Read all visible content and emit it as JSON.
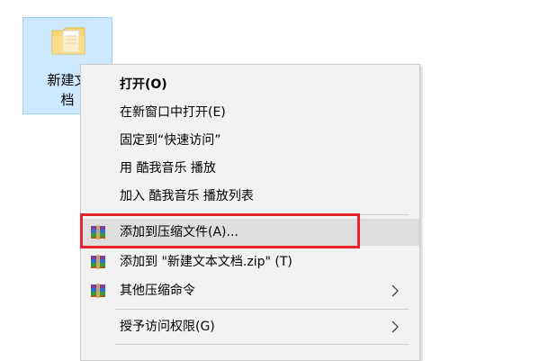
{
  "desktop": {
    "selected_item": {
      "name_line1": "新建文",
      "name_line2": "档",
      "icon": "text-document-icon"
    }
  },
  "context_menu": {
    "items": [
      {
        "label": "打开(O)",
        "bold": true
      },
      {
        "label": "在新窗口中打开(E)"
      },
      {
        "label": "固定到“快速访问”"
      },
      {
        "label": "用 酷我音乐 播放"
      },
      {
        "label": "加入 酷我音乐 播放列表"
      },
      {
        "label": "添加到压缩文件(A)...",
        "icon": "winrar-archive-icon",
        "highlighted": true
      },
      {
        "label": "添加到 \"新建文本文档.zip\" (T)",
        "icon": "winrar-archive-icon"
      },
      {
        "label": "其他压缩命令",
        "icon": "winrar-archive-icon",
        "submenu": true
      },
      {
        "label": "授予访问权限(G)",
        "submenu": true
      }
    ]
  },
  "annotation": {
    "highlight_color": "#e8242c"
  }
}
